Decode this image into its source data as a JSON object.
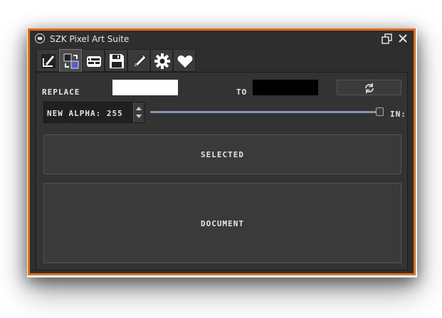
{
  "window": {
    "title": "SZK Pixel Art Suite",
    "border_color": "#e46b13",
    "background": "#2e2e2e"
  },
  "tabs": [
    {
      "icon": "pencil-ruler-icon",
      "active": false
    },
    {
      "icon": "color-swap-icon",
      "active": true
    },
    {
      "icon": "tiles-icon",
      "active": false
    },
    {
      "icon": "floppy-disk-icon",
      "active": false
    },
    {
      "icon": "pencil-icon",
      "active": false
    },
    {
      "icon": "gear-icon",
      "active": false
    },
    {
      "icon": "heart-icon",
      "active": false
    }
  ],
  "replace": {
    "label": "REPLACE",
    "from_color": "#ffffff",
    "to_label": "TO",
    "to_color": "#000000",
    "swap_icon": "refresh-icon"
  },
  "alpha": {
    "label": "NEW ALPHA: 255",
    "value": 255,
    "slider_fraction": 1.0,
    "suffix_label": "IN:"
  },
  "actions": {
    "selected_label": "SELECTED",
    "document_label": "DOCUMENT"
  }
}
